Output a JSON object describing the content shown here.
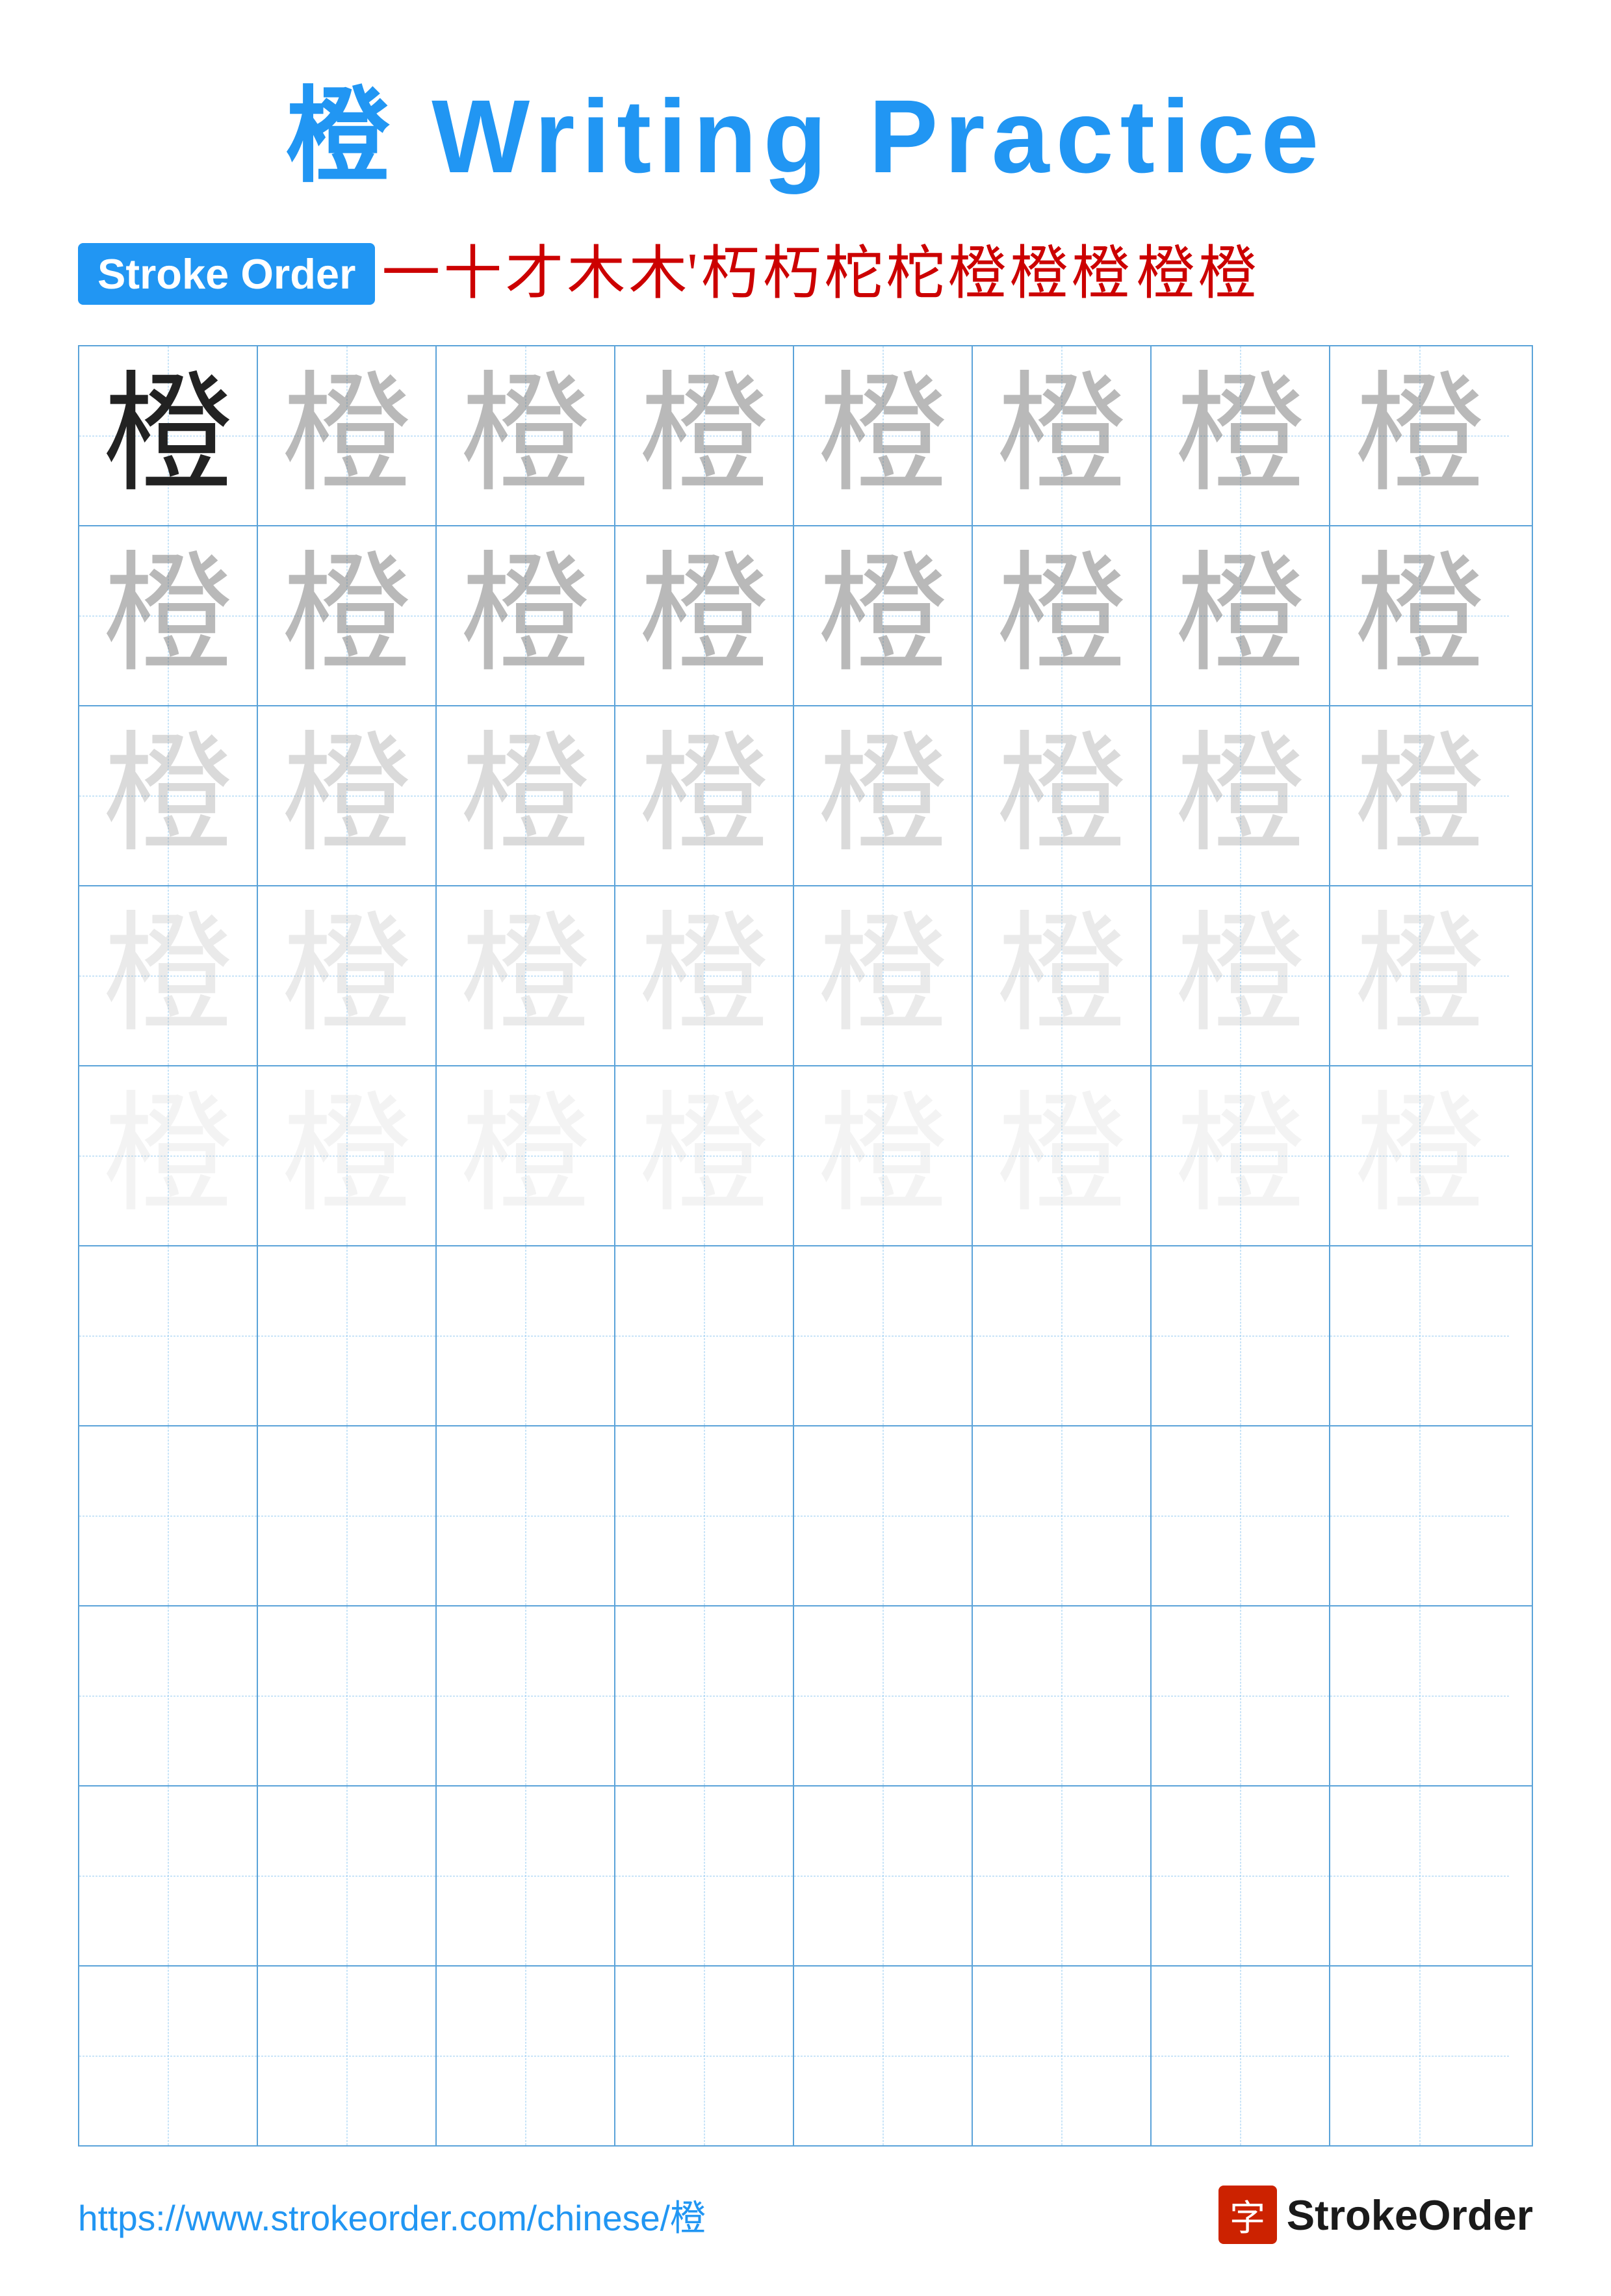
{
  "title": {
    "char": "橙",
    "text": " Writing Practice"
  },
  "stroke_order": {
    "label": "Stroke Order",
    "strokes": [
      "一",
      "十",
      "才",
      "木",
      "木'",
      "朽",
      "朽",
      "柁",
      "柁",
      "橙",
      "橙",
      "橙",
      "橙",
      "橙"
    ]
  },
  "practice_char": "橙",
  "grid": {
    "rows": 10,
    "cols": 8,
    "filled_rows": 5,
    "empty_rows": 5
  },
  "footer": {
    "url": "https://www.strokeorder.com/chinese/橙",
    "logo_char": "字",
    "logo_name": "StrokeOrder"
  }
}
